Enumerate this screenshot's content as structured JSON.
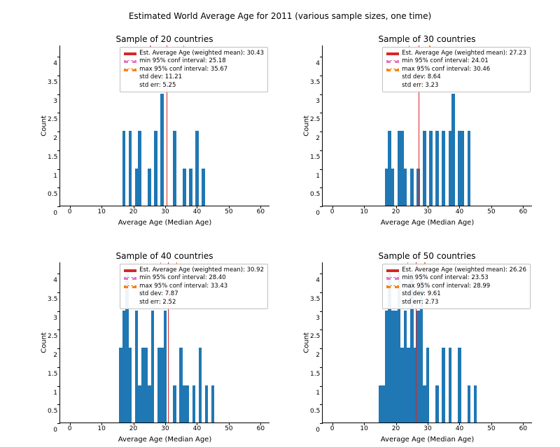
{
  "suptitle": "Estimated World Average Age for 2011 (various sample sizes, one time)",
  "xlabel": "Average Age (Median Age)",
  "ylabel": "Count",
  "axes": {
    "xticks": [
      0,
      10,
      20,
      30,
      40,
      50,
      60
    ],
    "xlim": [
      -3,
      63
    ]
  },
  "legend_labels": {
    "mean_prefix": "Est. Average Age (weighted mean): ",
    "min_prefix": "min 95% conf interval: ",
    "max_prefix": "max 95% conf interval: ",
    "std_prefix": "std dev: ",
    "se_prefix": "std err: "
  },
  "chart_data": [
    {
      "title": "Sample of 20 countries",
      "ymax": 4.3,
      "yticks": [
        0,
        0.5,
        1.0,
        1.5,
        2.0,
        2.5,
        3.0,
        3.5,
        4.0
      ],
      "mean": 30.43,
      "min95": 25.18,
      "max95": 35.67,
      "std": 11.21,
      "se": 5.25,
      "bars": [
        {
          "x": 17,
          "count": 2
        },
        {
          "x": 19,
          "count": 2
        },
        {
          "x": 21,
          "count": 1
        },
        {
          "x": 22,
          "count": 2
        },
        {
          "x": 25,
          "count": 1
        },
        {
          "x": 27,
          "count": 2
        },
        {
          "x": 29,
          "count": 3
        },
        {
          "x": 33,
          "count": 2
        },
        {
          "x": 36,
          "count": 1
        },
        {
          "x": 38,
          "count": 1
        },
        {
          "x": 40,
          "count": 2
        },
        {
          "x": 42,
          "count": 1
        }
      ]
    },
    {
      "title": "Sample of 30 countries",
      "ymax": 4.3,
      "yticks": [
        0,
        0.5,
        1.0,
        1.5,
        2.0,
        2.5,
        3.0,
        3.5,
        4.0
      ],
      "mean": 27.23,
      "min95": 24.01,
      "max95": 30.46,
      "std": 8.64,
      "se": 3.23,
      "bars": [
        {
          "x": 17,
          "count": 1
        },
        {
          "x": 18,
          "count": 2
        },
        {
          "x": 19,
          "count": 1
        },
        {
          "x": 21,
          "count": 2
        },
        {
          "x": 22,
          "count": 2
        },
        {
          "x": 23,
          "count": 1
        },
        {
          "x": 25,
          "count": 1
        },
        {
          "x": 27,
          "count": 1
        },
        {
          "x": 29,
          "count": 2
        },
        {
          "x": 31,
          "count": 2
        },
        {
          "x": 33,
          "count": 2
        },
        {
          "x": 35,
          "count": 2
        },
        {
          "x": 37,
          "count": 2
        },
        {
          "x": 38,
          "count": 3
        },
        {
          "x": 40,
          "count": 2
        },
        {
          "x": 41,
          "count": 2
        },
        {
          "x": 43,
          "count": 2
        }
      ]
    },
    {
      "title": "Sample of 40 countries",
      "ymax": 4.3,
      "yticks": [
        0,
        0.5,
        1.0,
        1.5,
        2.0,
        2.5,
        3.0,
        3.5,
        4.0
      ],
      "mean": 30.92,
      "min95": 28.4,
      "max95": 33.43,
      "std": 7.87,
      "se": 2.52,
      "bars": [
        {
          "x": 16,
          "count": 2
        },
        {
          "x": 17,
          "count": 3
        },
        {
          "x": 18,
          "count": 4
        },
        {
          "x": 19,
          "count": 2
        },
        {
          "x": 21,
          "count": 3
        },
        {
          "x": 22,
          "count": 1
        },
        {
          "x": 23,
          "count": 2
        },
        {
          "x": 24,
          "count": 2
        },
        {
          "x": 25,
          "count": 1
        },
        {
          "x": 26,
          "count": 3
        },
        {
          "x": 28,
          "count": 2
        },
        {
          "x": 29,
          "count": 2
        },
        {
          "x": 30,
          "count": 3
        },
        {
          "x": 33,
          "count": 1
        },
        {
          "x": 35,
          "count": 2
        },
        {
          "x": 36,
          "count": 1
        },
        {
          "x": 37,
          "count": 1
        },
        {
          "x": 39,
          "count": 1
        },
        {
          "x": 41,
          "count": 2
        },
        {
          "x": 43,
          "count": 1
        },
        {
          "x": 45,
          "count": 1
        }
      ]
    },
    {
      "title": "Sample of 50 countries",
      "ymax": 4.3,
      "yticks": [
        0,
        0.5,
        1.0,
        1.5,
        2.0,
        2.5,
        3.0,
        3.5,
        4.0
      ],
      "mean": 26.26,
      "min95": 23.53,
      "max95": 28.99,
      "std": 9.61,
      "se": 2.73,
      "bars": [
        {
          "x": 15,
          "count": 1
        },
        {
          "x": 16,
          "count": 1
        },
        {
          "x": 17,
          "count": 3
        },
        {
          "x": 18,
          "count": 4
        },
        {
          "x": 19,
          "count": 3
        },
        {
          "x": 20,
          "count": 3
        },
        {
          "x": 21,
          "count": 4
        },
        {
          "x": 22,
          "count": 2
        },
        {
          "x": 23,
          "count": 3
        },
        {
          "x": 24,
          "count": 2
        },
        {
          "x": 25,
          "count": 4
        },
        {
          "x": 26,
          "count": 2
        },
        {
          "x": 27,
          "count": 3
        },
        {
          "x": 28,
          "count": 4
        },
        {
          "x": 29,
          "count": 1
        },
        {
          "x": 30,
          "count": 2
        },
        {
          "x": 33,
          "count": 1
        },
        {
          "x": 35,
          "count": 2
        },
        {
          "x": 37,
          "count": 2
        },
        {
          "x": 40,
          "count": 2
        },
        {
          "x": 43,
          "count": 1
        },
        {
          "x": 45,
          "count": 1
        }
      ]
    }
  ]
}
